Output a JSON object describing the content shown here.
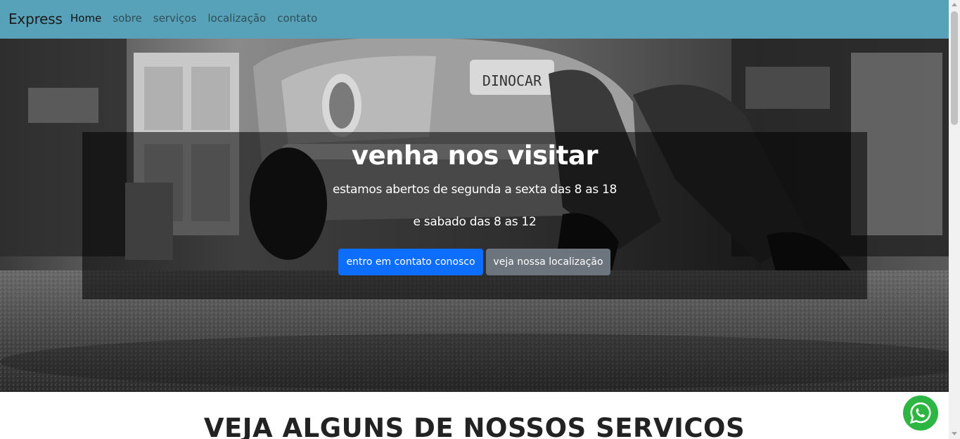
{
  "navbar": {
    "brand": "Express",
    "links": [
      {
        "label": "Home",
        "active": true
      },
      {
        "label": "sobre"
      },
      {
        "label": "serviços"
      },
      {
        "label": "localização"
      },
      {
        "label": "contato"
      }
    ]
  },
  "hero": {
    "title": "venha nos visitar",
    "line1": "estamos abertos de segunda a sexta das 8 as 18",
    "line2": "e sabado das 8 as 12",
    "primary_button": "entro em contato conosco",
    "secondary_button": "veja nossa localização",
    "plate_text": "DINOCAR"
  },
  "section": {
    "title": "VEJA ALGUNS DE NOSSOS SERVICOS"
  },
  "colors": {
    "navbar": "#57a2b9",
    "primary": "#0d6efd",
    "secondary": "#6c757d",
    "whatsapp": "#2db742"
  },
  "icons": {
    "whatsapp": "whatsapp-icon"
  }
}
